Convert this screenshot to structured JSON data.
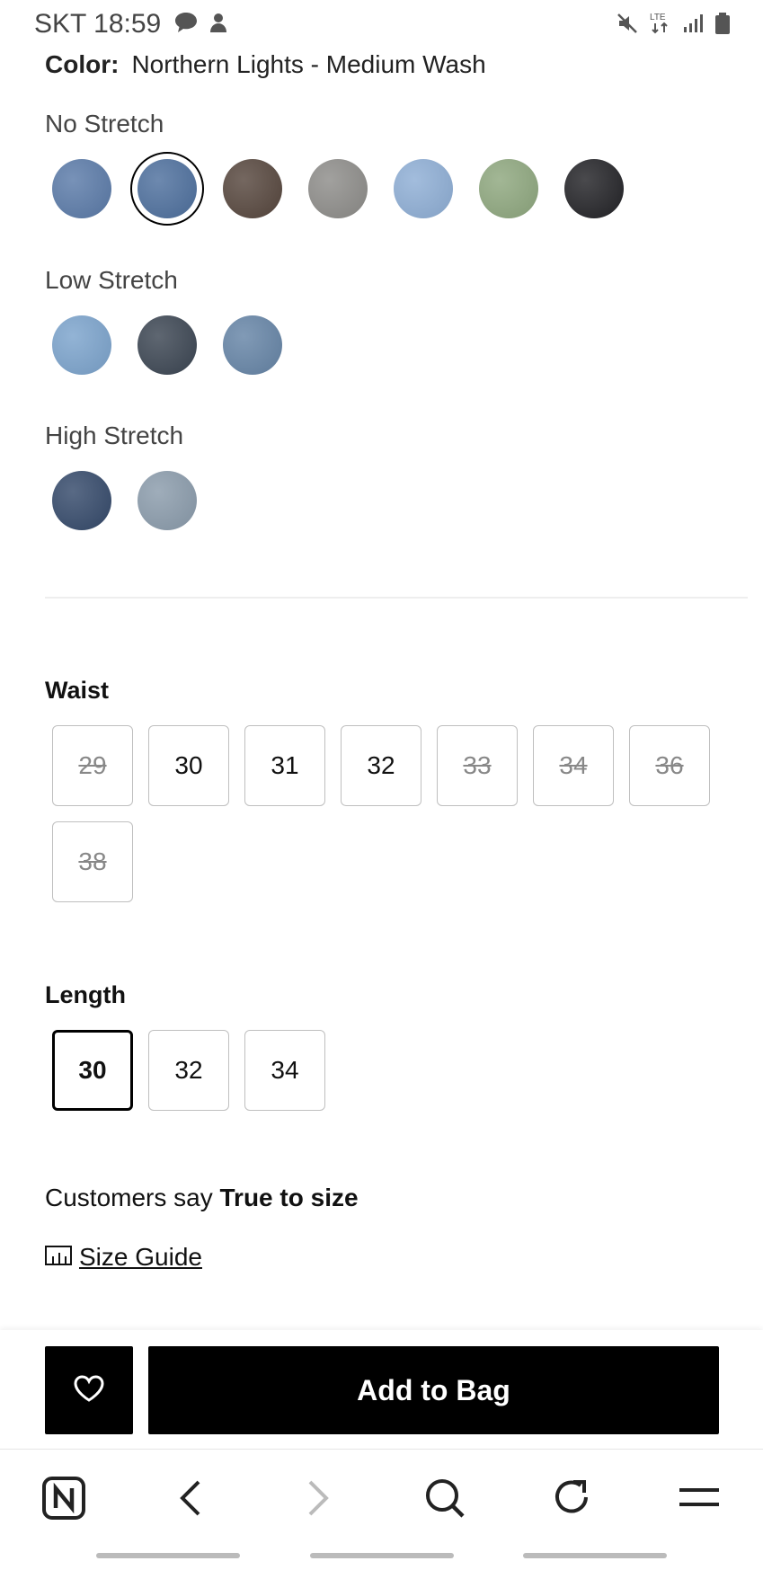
{
  "status_bar": {
    "carrier_time": "SKT 18:59"
  },
  "color": {
    "label": "Color:",
    "value": "Northern Lights - Medium Wash"
  },
  "swatch_groups": [
    {
      "label": "No Stretch",
      "swatches": [
        "#5a7aa8",
        "#4d6f9d",
        "#56463d",
        "#8d8c89",
        "#8eaed5",
        "#8ea77e",
        "#222226"
      ],
      "selected_index": 1
    },
    {
      "label": "Low Stretch",
      "swatches": [
        "#7ba3cc",
        "#3b4552",
        "#6584a6"
      ]
    },
    {
      "label": "High Stretch",
      "swatches": [
        "#34496a",
        "#8a9bab"
      ]
    }
  ],
  "waist": {
    "title": "Waist",
    "sizes": [
      {
        "label": "29",
        "available": false
      },
      {
        "label": "30",
        "available": true
      },
      {
        "label": "31",
        "available": true
      },
      {
        "label": "32",
        "available": true
      },
      {
        "label": "33",
        "available": false
      },
      {
        "label": "34",
        "available": false
      },
      {
        "label": "36",
        "available": false
      },
      {
        "label": "38",
        "available": false
      }
    ]
  },
  "length": {
    "title": "Length",
    "sizes": [
      {
        "label": "30",
        "available": true,
        "selected": true
      },
      {
        "label": "32",
        "available": true
      },
      {
        "label": "34",
        "available": true
      }
    ]
  },
  "fit": {
    "prefix": "Customers say ",
    "value": "True to size"
  },
  "size_guide": {
    "label": "Size Guide"
  },
  "actions": {
    "add_to_bag": "Add to Bag"
  }
}
